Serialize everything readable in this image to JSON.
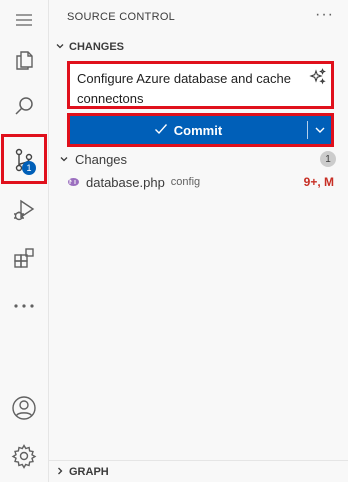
{
  "activity_bar": {
    "scm_badge": "1"
  },
  "sidebar": {
    "title": "SOURCE CONTROL",
    "more": "···"
  },
  "changes_section": {
    "title": "CHANGES",
    "commit_message": "Configure Azure database and cache connectons",
    "commit_label": "Commit",
    "group_label": "Changes",
    "group_count": "1",
    "files": [
      {
        "name": "database.php",
        "folder": "config",
        "status": "9+, M"
      }
    ]
  },
  "graph_section": {
    "title": "GRAPH"
  },
  "colors": {
    "accent": "#005fb8",
    "highlight": "#e0101c",
    "modified": "#c72e24"
  }
}
